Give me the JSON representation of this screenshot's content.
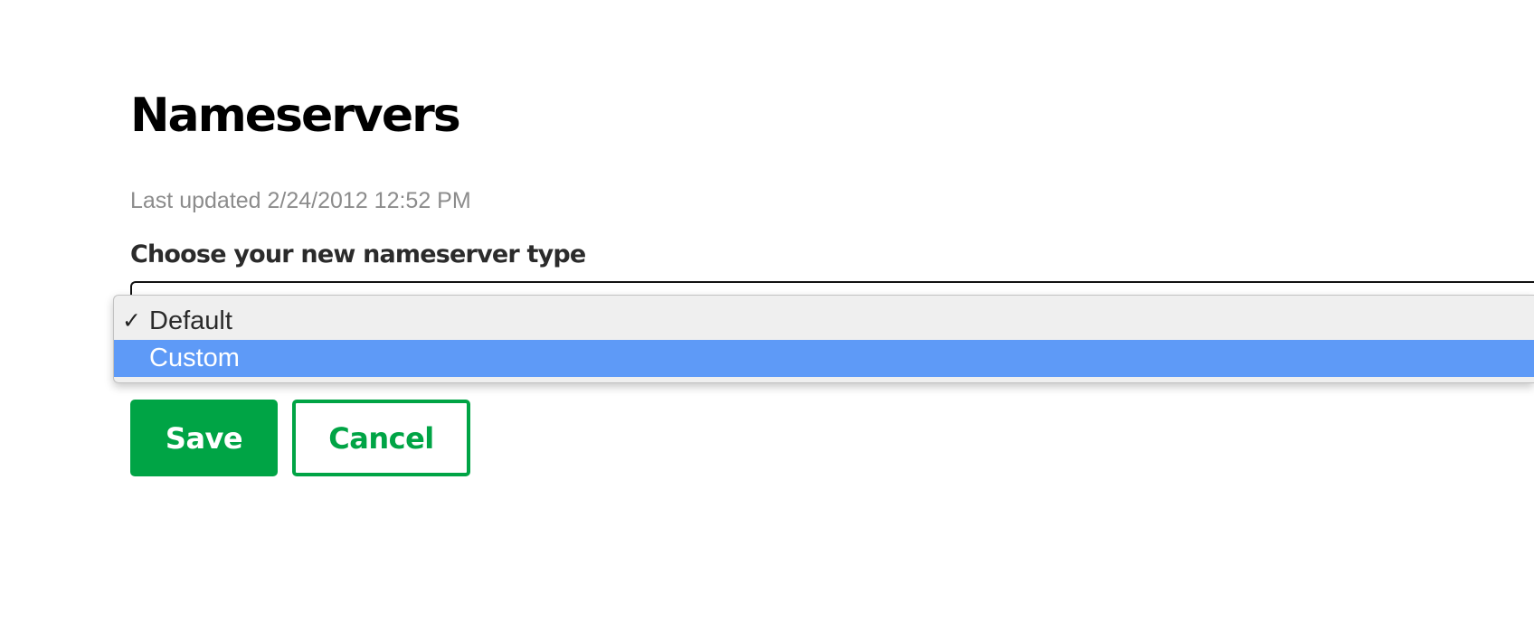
{
  "page": {
    "title": "Nameservers",
    "last_updated": "Last updated 2/24/2012 12:52 PM"
  },
  "form": {
    "label": "Choose your new nameserver type",
    "select": {
      "selected_value": "Default",
      "highlighted_value": "Custom",
      "options": [
        {
          "label": "Default",
          "checked": true,
          "highlighted": false
        },
        {
          "label": "Custom",
          "checked": false,
          "highlighted": true
        }
      ],
      "check_glyph": "✓"
    }
  },
  "actions": {
    "save_label": "Save",
    "cancel_label": "Cancel"
  },
  "colors": {
    "accent_green": "#00a445",
    "highlight_blue": "#5e9af7",
    "muted_text": "#8c8c8c"
  }
}
